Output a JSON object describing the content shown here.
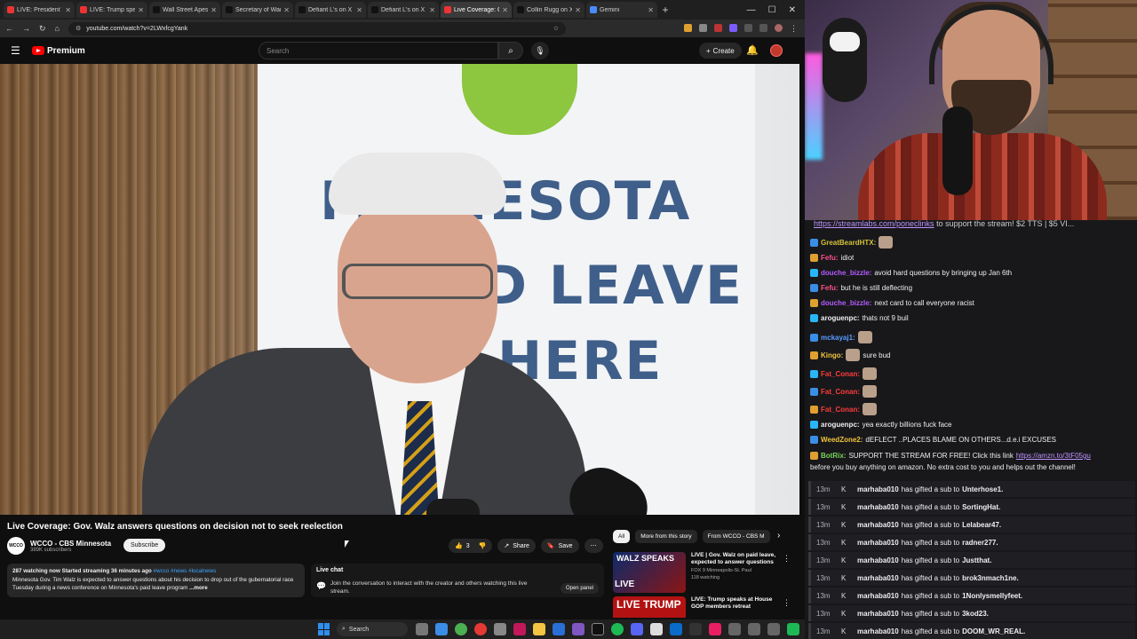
{
  "browser": {
    "tabs": [
      {
        "label": "LIVE: President T",
        "color": "#e33"
      },
      {
        "label": "LIVE: Trump speaks a",
        "color": "#e33"
      },
      {
        "label": "Wall Street Apes",
        "color": "#111"
      },
      {
        "label": "Secretary of War Pe",
        "color": "#111"
      },
      {
        "label": "Defiant L's on X",
        "color": "#111"
      },
      {
        "label": "Defiant L's on X",
        "color": "#111"
      },
      {
        "label": "Live Coverage: G",
        "color": "#e33"
      },
      {
        "label": "Collin Rugg on X",
        "color": "#111"
      },
      {
        "label": "Gemini",
        "color": "#4a8cff"
      }
    ],
    "url": "youtube.com/watch?v=2LWxfcgYank"
  },
  "youtube": {
    "brand": "Premium",
    "search_placeholder": "Search",
    "create_label": "Create",
    "video_title": "Live Coverage: Gov. Walz answers questions on decision not to seek reelection",
    "channel": {
      "name": "WCCO - CBS Minnesota",
      "subs": "389K subscribers",
      "logo_text": "WCCO"
    },
    "subscribe_label": "Subscribe",
    "likes": "3",
    "share_label": "Share",
    "save_label": "Save",
    "description": {
      "stats": "287 watching now  Started streaming 36 minutes ago",
      "tags": "#wcco #news #localnews",
      "body": "Minnesota Gov. Tim Walz is expected to answer questions about his decision to drop out of the gubernatorial race Tuesday during a news conference on Minnesota's paid leave program",
      "more": "...more"
    },
    "live_chat": {
      "heading": "Live chat",
      "text": "Join the conversation to interact with the creator and others watching this live stream.",
      "open_label": "Open panel"
    },
    "filters": [
      "All",
      "More from this story",
      "From WCCO - CBS M"
    ],
    "recommendations": [
      {
        "thumb_text": "WALZ SPEAKS",
        "thumb_live": "LIVE",
        "title": "LIVE | Gov. Walz on paid leave, expected to answer questions",
        "channel": "FOX 9 Minneapolis-St. Paul",
        "meta": "118 watching"
      },
      {
        "thumb_text": "LIVE TRUMP",
        "thumb_live": "",
        "title": "LIVE: Trump speaks at House GOP members retreat",
        "channel": "",
        "meta": ""
      }
    ],
    "video_banner": {
      "line1": "MINNESOTA",
      "line2": "PAID LEAVE",
      "line3": "HERE"
    }
  },
  "taskbar": {
    "search_label": "Search"
  },
  "chat": {
    "banner_link": "https://streamlabs.com/poneclinks",
    "banner_text": " to support the stream! $2 TTS | $5 VI...",
    "messages": [
      {
        "user": "GreatBeardHTX:",
        "text": "",
        "color": "#d4c23a",
        "emote": true
      },
      {
        "user": "Fefu:",
        "text": "idiot",
        "color": "#ff4f8b",
        "emote": false
      },
      {
        "user": "douche_bizzle:",
        "text": "avoid hard questions by bringing up Jan 6th",
        "color": "#b45bff",
        "emote": false
      },
      {
        "user": "Fefu:",
        "text": "but he is still deflecting",
        "color": "#ff4f8b",
        "emote": false
      },
      {
        "user": "douche_bizzle:",
        "text": "next card to call everyone racist",
        "color": "#b45bff",
        "emote": false
      },
      {
        "user": "aroguenpc:",
        "text": "thats not 9 buil",
        "color": "#efeff1",
        "emote": false
      },
      {
        "user": "mckayaj1:",
        "text": "",
        "color": "#5b9cff",
        "emote": true
      },
      {
        "user": "Kingo:",
        "text": "sure bud",
        "color": "#f0c43b",
        "emote": true
      },
      {
        "user": "Fat_Conan:",
        "text": "",
        "color": "#ff3b3b",
        "emote": true
      },
      {
        "user": "Fat_Conan:",
        "text": "",
        "color": "#ff3b3b",
        "emote": true
      },
      {
        "user": "Fat_Conan:",
        "text": "",
        "color": "#ff3b3b",
        "emote": true
      },
      {
        "user": "aroguenpc:",
        "text": "yea exactly billions fuck face",
        "color": "#efeff1",
        "emote": false
      },
      {
        "user": "WeedZone2:",
        "text": "dEFLECT ..PLACES BLAME ON OTHERS...d.e.i EXCUSES",
        "color": "#f0c43b",
        "emote": false
      },
      {
        "user": "BotRix:",
        "text": "SUPPORT THE STREAM FOR FREE! Click this link ",
        "link": "https://amzn.to/3tF05gu",
        "color": "#7bd45a",
        "emote": false
      },
      {
        "user": "",
        "text": "before you buy anything on amazon. No extra cost to you and helps out the channel!",
        "color": "#efeff1",
        "emote": false
      }
    ],
    "gift_time": "13m",
    "gifter": "marhaba010",
    "gift_phrase": "has gifted a sub to",
    "gifts": [
      "Unterhose1.",
      "SortingHat.",
      "Lelabear47.",
      "radner277.",
      "Justthat.",
      "brok3nmach1ne.",
      "1Nonlysmellyfeet.",
      "3kod23.",
      "DOOM_WR_REAL."
    ]
  }
}
